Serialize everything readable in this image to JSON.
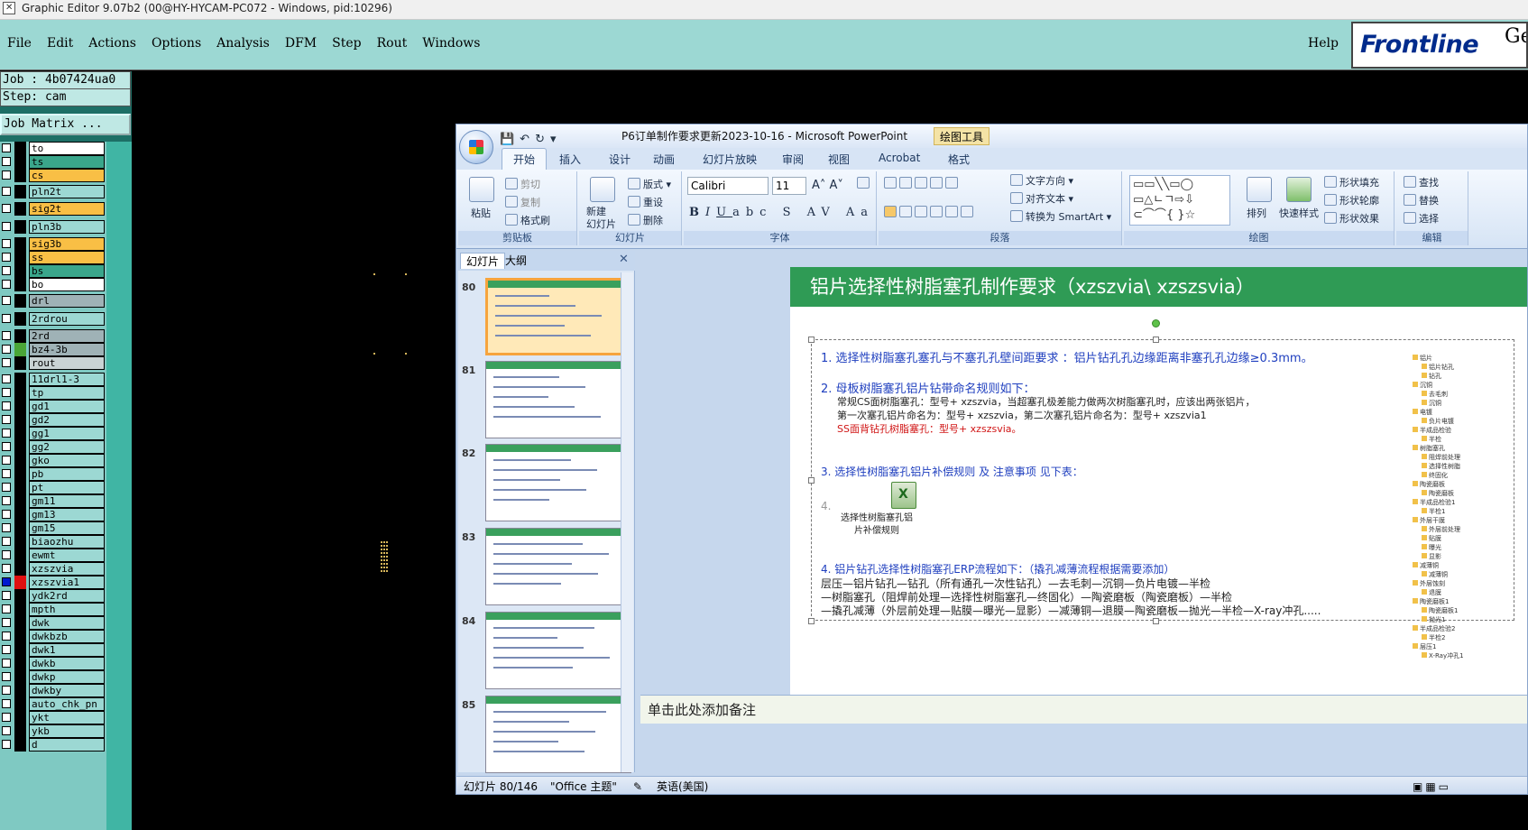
{
  "genesis": {
    "title": "Graphic Editor 9.07b2 (00@HY-HYCAM-PC072 - Windows, pid:10296)",
    "menu": [
      "File",
      "Edit",
      "Actions",
      "Options",
      "Analysis",
      "DFM",
      "Step",
      "Rout",
      "Windows"
    ],
    "help": "Help",
    "logo": "Frontline",
    "logo_suffix": "Ge",
    "job": "Job : 4b07424ua0",
    "step": "Step: cam",
    "job_matrix": "Job Matrix ...",
    "layers": [
      {
        "name": "to",
        "color": "#ffffff",
        "swatch": "#000000",
        "selected": false
      },
      {
        "name": "ts",
        "color": "#3aa68b",
        "swatch": "#000000",
        "selected": false
      },
      {
        "name": "cs",
        "color": "#f9bf45",
        "swatch": "#000000",
        "selected": false
      },
      {
        "name": "pln2t",
        "color": "#9cd8d3",
        "swatch": "#000000",
        "selected": false
      },
      {
        "name": "sig2t",
        "color": "#f9bf45",
        "swatch": "#000000",
        "selected": false
      },
      {
        "name": "pln3b",
        "color": "#9cd8d3",
        "swatch": "#000000",
        "selected": false
      },
      {
        "name": "sig3b",
        "color": "#f9bf45",
        "swatch": "#000000",
        "selected": false
      },
      {
        "name": "ss",
        "color": "#f9bf45",
        "swatch": "#000000",
        "selected": false
      },
      {
        "name": "bs",
        "color": "#3aa68b",
        "swatch": "#000000",
        "selected": false
      },
      {
        "name": "bo",
        "color": "#ffffff",
        "swatch": "#000000",
        "selected": false
      },
      {
        "name": "drl",
        "color": "#9fb2b6",
        "swatch": "#000000",
        "selected": false
      },
      {
        "name": "2rdrou",
        "color": "#9cd8d3",
        "swatch": "#000000",
        "selected": false
      },
      {
        "name": "2rd",
        "color": "#9fb2b6",
        "swatch": "#000000",
        "selected": false
      },
      {
        "name": "bz4-3b",
        "color": "#9fb2b6",
        "swatch": "#4aa637",
        "selected": false
      },
      {
        "name": "rout",
        "color": "#c9d3d4",
        "swatch": "#000000",
        "selected": false
      },
      {
        "name": "11drl1-3",
        "color": "#9cd8d3",
        "swatch": "#000000",
        "selected": false
      },
      {
        "name": "tp",
        "color": "#9cd8d3",
        "swatch": "#000000",
        "selected": false
      },
      {
        "name": "gd1",
        "color": "#9cd8d3",
        "swatch": "#000000",
        "selected": false
      },
      {
        "name": "gd2",
        "color": "#9cd8d3",
        "swatch": "#000000",
        "selected": false
      },
      {
        "name": "gg1",
        "color": "#9cd8d3",
        "swatch": "#000000",
        "selected": false
      },
      {
        "name": "gg2",
        "color": "#9cd8d3",
        "swatch": "#000000",
        "selected": false
      },
      {
        "name": "gko",
        "color": "#9cd8d3",
        "swatch": "#000000",
        "selected": false
      },
      {
        "name": "pb",
        "color": "#9cd8d3",
        "swatch": "#000000",
        "selected": false
      },
      {
        "name": "pt",
        "color": "#9cd8d3",
        "swatch": "#000000",
        "selected": false
      },
      {
        "name": "gm11",
        "color": "#9cd8d3",
        "swatch": "#000000",
        "selected": false
      },
      {
        "name": "gm13",
        "color": "#9cd8d3",
        "swatch": "#000000",
        "selected": false
      },
      {
        "name": "gm15",
        "color": "#9cd8d3",
        "swatch": "#000000",
        "selected": false
      },
      {
        "name": "biaozhu",
        "color": "#9cd8d3",
        "swatch": "#000000",
        "selected": false
      },
      {
        "name": "ewmt",
        "color": "#9cd8d3",
        "swatch": "#000000",
        "selected": false
      },
      {
        "name": "xzszvia",
        "color": "#9cd8d3",
        "swatch": "#000000",
        "selected": false
      },
      {
        "name": "xzszvia1",
        "color": "#9cd8d3",
        "swatch": "#e01010",
        "selected": true
      },
      {
        "name": "ydk2rd",
        "color": "#9cd8d3",
        "swatch": "#000000",
        "selected": false
      },
      {
        "name": "mpth",
        "color": "#9cd8d3",
        "swatch": "#000000",
        "selected": false
      },
      {
        "name": "dwk",
        "color": "#9cd8d3",
        "swatch": "#000000",
        "selected": false
      },
      {
        "name": "dwkbzb",
        "color": "#9cd8d3",
        "swatch": "#000000",
        "selected": false
      },
      {
        "name": "dwk1",
        "color": "#9cd8d3",
        "swatch": "#000000",
        "selected": false
      },
      {
        "name": "dwkb",
        "color": "#9cd8d3",
        "swatch": "#000000",
        "selected": false
      },
      {
        "name": "dwkp",
        "color": "#9cd8d3",
        "swatch": "#000000",
        "selected": false
      },
      {
        "name": "dwkby",
        "color": "#9cd8d3",
        "swatch": "#000000",
        "selected": false
      },
      {
        "name": "auto_chk_pn",
        "color": "#9cd8d3",
        "swatch": "#000000",
        "selected": false
      },
      {
        "name": "ykt",
        "color": "#9cd8d3",
        "swatch": "#000000",
        "selected": false
      },
      {
        "name": "ykb",
        "color": "#9cd8d3",
        "swatch": "#000000",
        "selected": false
      },
      {
        "name": "d",
        "color": "#9cd8d3",
        "swatch": "#000000",
        "selected": false
      }
    ]
  },
  "ppt": {
    "title": "P6订单制作要求更新2023-10-16 - Microsoft PowerPoint",
    "drawing_tools": "绘图工具",
    "tabs": [
      "开始",
      "插入",
      "设计",
      "动画",
      "幻灯片放映",
      "审阅",
      "视图",
      "Acrobat",
      "格式"
    ],
    "ribbon": {
      "clipboard": {
        "label": "剪贴板",
        "paste": "粘贴",
        "cut": "剪切",
        "copy": "复制",
        "format_painter": "格式刷"
      },
      "slides": {
        "label": "幻灯片",
        "new_slide": "新建\n幻灯片",
        "layout": "版式",
        "reset": "重设",
        "delete": "删除"
      },
      "font": {
        "label": "字体",
        "name": "Calibri",
        "size": "11"
      },
      "paragraph": {
        "label": "段落",
        "text_direction": "文字方向",
        "align_text": "对齐文本",
        "smartart": "转换为 SmartArt"
      },
      "drawing": {
        "label": "绘图",
        "arrange": "排列",
        "quick_styles": "快速样式",
        "shape_fill": "形状填充",
        "shape_outline": "形状轮廓",
        "shape_effects": "形状效果"
      },
      "editing": {
        "label": "编辑",
        "find": "查找",
        "replace": "替换",
        "select": "选择"
      }
    },
    "pane_tabs": [
      "幻灯片",
      "大纲"
    ],
    "thumbs": [
      "80",
      "81",
      "82",
      "83",
      "84",
      "85"
    ],
    "slide": {
      "title": "铝片选择性树脂塞孔制作要求（xzszvia\\ xzszsvia）",
      "item1": "1.   选择性树脂塞孔塞孔与不塞孔孔壁间距要求 ：铝片钻孔孔边缘距离非塞孔孔边缘≥0.3mm。",
      "item2": "2.   母板树脂塞孔铝片钻带命名规则如下：",
      "item2a": "常规CS面树脂塞孔：型号+ xzszvia，当超塞孔极差能力做两次树脂塞孔时，应该出两张铝片，",
      "item2b": "第一次塞孔铝片命名为：型号+ xzszvia，第二次塞孔铝片命名为：型号+ xzszvia1",
      "item2c": "SS面背钻孔树脂塞孔：型号+ xzszsvia。",
      "item3": "3.   选择性树脂塞孔铝片补偿规则 及 注意事项 见下表：",
      "item4num": "4.",
      "embed_label": "选择性树脂塞孔铝\n片补偿规则",
      "item4": "4.   铝片钻孔选择性树脂塞孔ERP流程如下：（撬孔减薄流程根据需要添加）",
      "flow1": "层压—铝片钻孔—钻孔（所有通孔一次性钻孔）—去毛刺—沉铜—负片电镀—半检",
      "flow2": "—树脂塞孔（阻焊前处理—选择性树脂塞孔—终固化）—陶瓷磨板（陶瓷磨板）—半检",
      "flow3": "—撬孔减薄（外层前处理—贴膜—曝光—显影）—减薄铜—退膜—陶瓷磨板—抛光—半检—X-ray冲孔.....",
      "tree": [
        "铝片",
        "铝片钻孔",
        "钻孔",
        "沉铜",
        "去毛刺",
        "沉铜",
        "电镀",
        "负片电镀",
        "半成品检验",
        "半检",
        "树脂塞孔",
        "阻焊前处理",
        "选择性树脂",
        "终固化",
        "陶瓷磨板",
        "陶瓷磨板",
        "半成品检验1",
        "半检1",
        "外层干膜",
        "外层前处理",
        "贴膜",
        "曝光",
        "显影",
        "减薄铜",
        "减薄铜",
        "外层蚀刻",
        "退膜",
        "陶瓷磨板1",
        "陶瓷磨板1",
        "抛光1",
        "半成品检验2",
        "半检2",
        "层压1",
        "X-Ray冲孔1"
      ]
    },
    "notes": "单击此处添加备注",
    "status": {
      "slide": "幻灯片 80/146",
      "theme": "\"Office 主题\"",
      "lang": "英语(美国)"
    }
  }
}
